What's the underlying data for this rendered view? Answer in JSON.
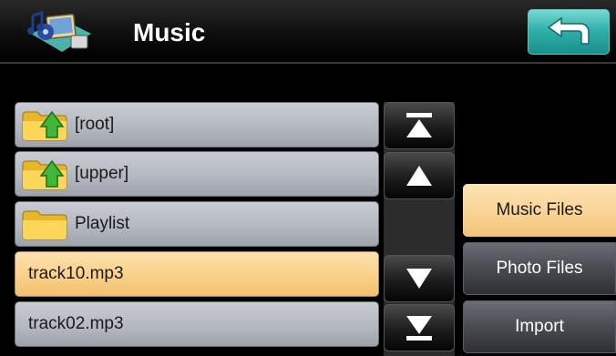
{
  "header": {
    "title": "Music",
    "app_icon": "media-icon",
    "back_icon": "back-arrow-icon"
  },
  "list": {
    "items": [
      {
        "label": "[root]",
        "icon": "folder-up-icon",
        "selected": false
      },
      {
        "label": "[upper]",
        "icon": "folder-up-icon",
        "selected": false
      },
      {
        "label": "Playlist",
        "icon": "folder-icon",
        "selected": false
      },
      {
        "label": "track10.mp3",
        "icon": "",
        "selected": true
      },
      {
        "label": "track02.mp3",
        "icon": "",
        "selected": false
      }
    ]
  },
  "scroll": {
    "buttons": [
      "scroll-top-icon",
      "scroll-up-icon",
      "scroll-down-icon",
      "scroll-bottom-icon"
    ]
  },
  "side": {
    "music_label": "Music Files",
    "photo_label": "Photo Files",
    "import_label": "Import"
  },
  "colors": {
    "selected": "#f9cf86",
    "row": "#b4b8c0",
    "accent": "#2fb1aa"
  }
}
